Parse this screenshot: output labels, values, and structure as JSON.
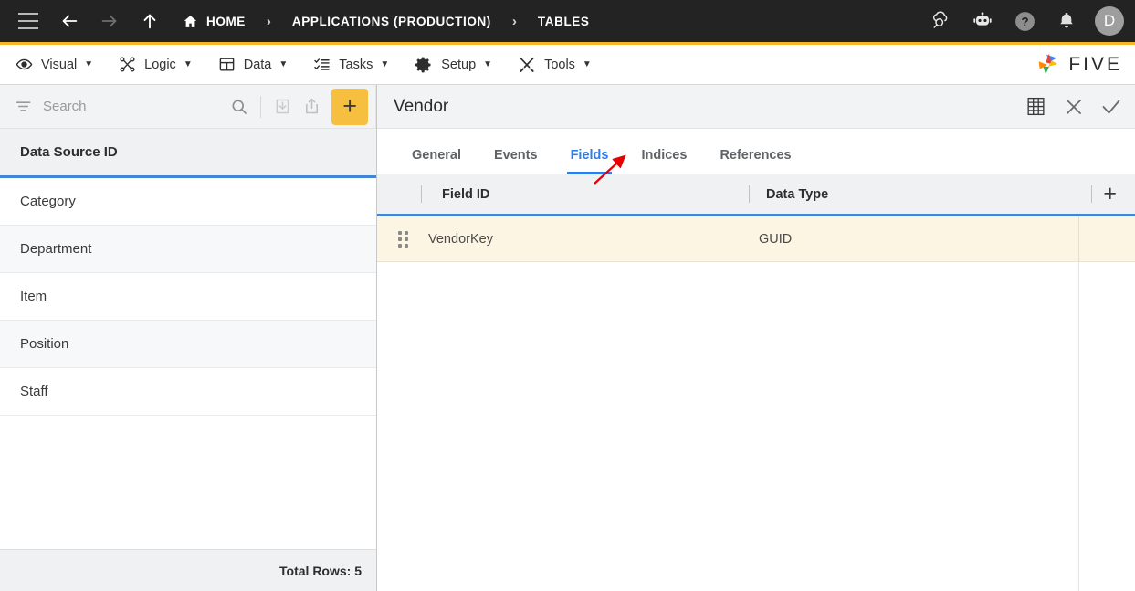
{
  "topbar": {
    "menu_icon": "hamburger-icon",
    "back_icon": "arrow-left-icon",
    "forward_icon": "arrow-right-icon",
    "up_icon": "arrow-up-icon",
    "breadcrumbs": [
      {
        "label": "HOME",
        "icon": "home-icon"
      },
      {
        "label": "APPLICATIONS (PRODUCTION)",
        "icon": ""
      },
      {
        "label": "TABLES",
        "icon": ""
      }
    ],
    "separator": "›",
    "actions": [
      {
        "name": "cloud-search-icon"
      },
      {
        "name": "chatbot-icon"
      },
      {
        "name": "help-icon"
      },
      {
        "name": "notifications-bell-icon"
      }
    ],
    "avatar_initial": "D",
    "accent_color": "#f5b724",
    "background": "#232323"
  },
  "menubar": {
    "items": [
      {
        "label": "Visual",
        "icon": "eye-icon",
        "caret": "▼"
      },
      {
        "label": "Logic",
        "icon": "logic-nodes-icon",
        "caret": "▼"
      },
      {
        "label": "Data",
        "icon": "table-grid-icon",
        "caret": "▼"
      },
      {
        "label": "Tasks",
        "icon": "tasks-list-icon",
        "caret": "▼"
      },
      {
        "label": "Setup",
        "icon": "gear-icon",
        "caret": "▼"
      },
      {
        "label": "Tools",
        "icon": "tools-icon",
        "caret": "▼"
      }
    ],
    "brand": "FIVE"
  },
  "sidebar": {
    "search": {
      "placeholder": "Search",
      "value": ""
    },
    "toolbar": {
      "filter_icon": "filter-icon",
      "search_icon": "search-icon",
      "import_icon": "import-download-icon",
      "export_icon": "export-share-icon",
      "add_label": "+"
    },
    "column_header": "Data Source ID",
    "items": [
      {
        "label": "Category"
      },
      {
        "label": "Department"
      },
      {
        "label": "Item"
      },
      {
        "label": "Position"
      },
      {
        "label": "Staff"
      }
    ],
    "footer": "Total Rows: 5"
  },
  "main": {
    "title": "Vendor",
    "header_actions": [
      {
        "name": "table-view-icon"
      },
      {
        "name": "close-icon"
      },
      {
        "name": "save-check-icon"
      }
    ],
    "tabs": [
      {
        "label": "General",
        "active": false
      },
      {
        "label": "Events",
        "active": false
      },
      {
        "label": "Fields",
        "active": true
      },
      {
        "label": "Indices",
        "active": false
      },
      {
        "label": "References",
        "active": false
      }
    ],
    "table": {
      "columns": [
        {
          "label": "Field ID"
        },
        {
          "label": "Data Type"
        }
      ],
      "add_label": "+",
      "rows": [
        {
          "field_id": "VendorKey",
          "data_type": "GUID"
        }
      ]
    }
  },
  "annotation": {
    "arrow_color": "#e60000",
    "points_to": "Indices"
  }
}
